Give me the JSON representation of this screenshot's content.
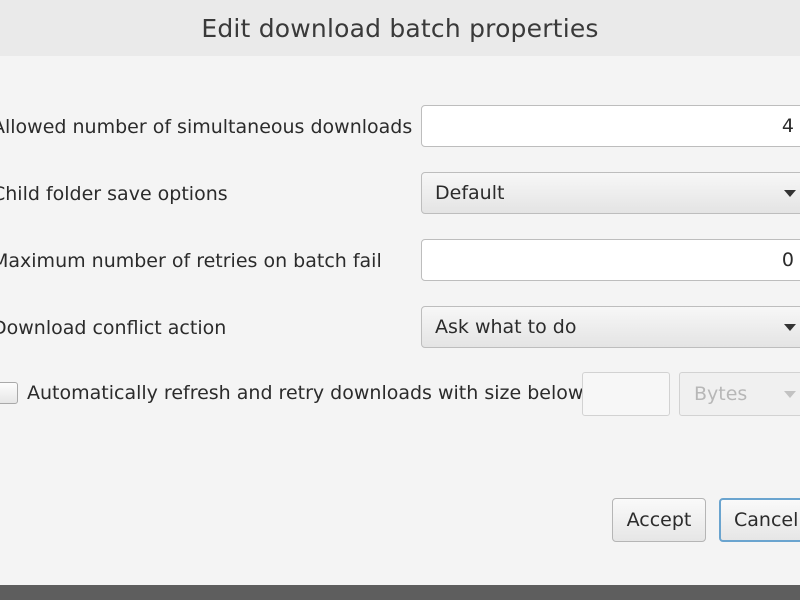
{
  "dialog": {
    "title": "Edit download batch properties"
  },
  "fields": {
    "simultaneous_downloads": {
      "label": "Allowed number of simultaneous downloads",
      "value": "4"
    },
    "child_folder_options": {
      "label": "Child folder save options",
      "selected": "Default"
    },
    "max_retries": {
      "label": "Maximum number of retries on batch fail",
      "value": "0"
    },
    "conflict_action": {
      "label": "Download conflict action",
      "selected": "Ask what to do"
    },
    "auto_refresh": {
      "label": "Automatically refresh and retry downloads with size below",
      "checked": false,
      "size_value": "",
      "unit_selected": "Bytes",
      "enabled": false
    }
  },
  "buttons": {
    "accept": "Accept",
    "cancel": "Cancel"
  },
  "icons": {
    "combo_arrow": "chevron-down-icon"
  }
}
